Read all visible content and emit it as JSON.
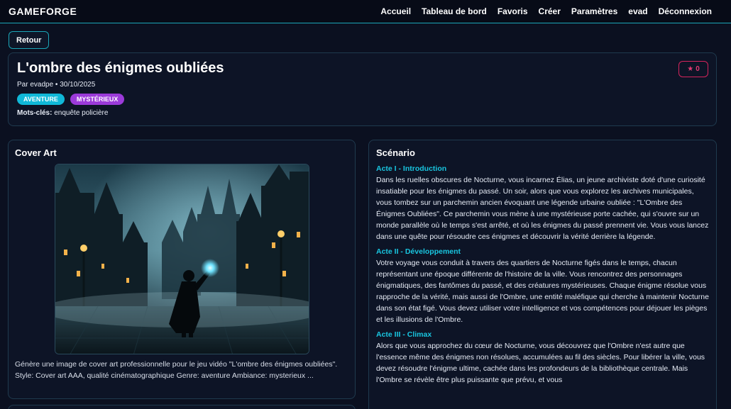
{
  "app": {
    "brand": "GAMEFORGE"
  },
  "nav": {
    "items": [
      "Accueil",
      "Tableau de bord",
      "Favoris",
      "Créer",
      "Paramètres",
      "evad",
      "Déconnexion"
    ]
  },
  "back_label": "Retour",
  "game": {
    "title": "L'ombre des énigmes oubliées",
    "meta": "Par evadpe • 30/10/2025",
    "tags": [
      "AVENTURE",
      "MYSTÉRIEUX"
    ],
    "keywords_label": "Mots-clés:",
    "keywords_value": " enquête policière",
    "fav_icon": "★",
    "fav_count": "0"
  },
  "colors": {
    "accent": "#19c6e0",
    "tag_adventure": "#10b8d8",
    "tag_mystery": "#9b3ad9",
    "favorite": "#e13a71"
  },
  "cover": {
    "title": "Cover Art",
    "prompt": "Génère une image de cover art professionnelle pour le jeu vidéo \"L'ombre des énigmes oubliées\". Style: Cover art AAA, qualité cinématographique Genre: aventure Ambiance: mysterieux ..."
  },
  "scenario": {
    "title": "Scénario",
    "acts": [
      {
        "title": "Acte I - Introduction",
        "text": "Dans les ruelles obscures de Nocturne, vous incarnez Élias, un jeune archiviste doté d'une curiosité insatiable pour les énigmes du passé. Un soir, alors que vous explorez les archives municipales, vous tombez sur un parchemin ancien évoquant une légende urbaine oubliée : \"L'Ombre des Énigmes Oubliées\". Ce parchemin vous mène à une mystérieuse porte cachée, qui s'ouvre sur un monde parallèle où le temps s'est arrêté, et où les énigmes du passé prennent vie. Vous vous lancez dans une quête pour résoudre ces énigmes et découvrir la vérité derrière la légende."
      },
      {
        "title": "Acte II - Développement",
        "text": "Votre voyage vous conduit à travers des quartiers de Nocturne figés dans le temps, chacun représentant une époque différente de l'histoire de la ville. Vous rencontrez des personnages énigmatiques, des fantômes du passé, et des créatures mystérieuses. Chaque énigme résolue vous rapproche de la vérité, mais aussi de l'Ombre, une entité maléfique qui cherche à maintenir Nocturne dans son état figé. Vous devez utiliser votre intelligence et vos compétences pour déjouer les pièges et les illusions de l'Ombre."
      },
      {
        "title": "Acte III - Climax",
        "text": "Alors que vous approchez du cœur de Nocturne, vous découvrez que l'Ombre n'est autre que l'essence même des énigmes non résolues, accumulées au fil des siècles. Pour libérer la ville, vous devez résoudre l'énigme ultime, cachée dans les profondeurs de la bibliothèque centrale. Mais l'Ombre se révèle être plus puissante que prévu, et vous"
      }
    ]
  }
}
